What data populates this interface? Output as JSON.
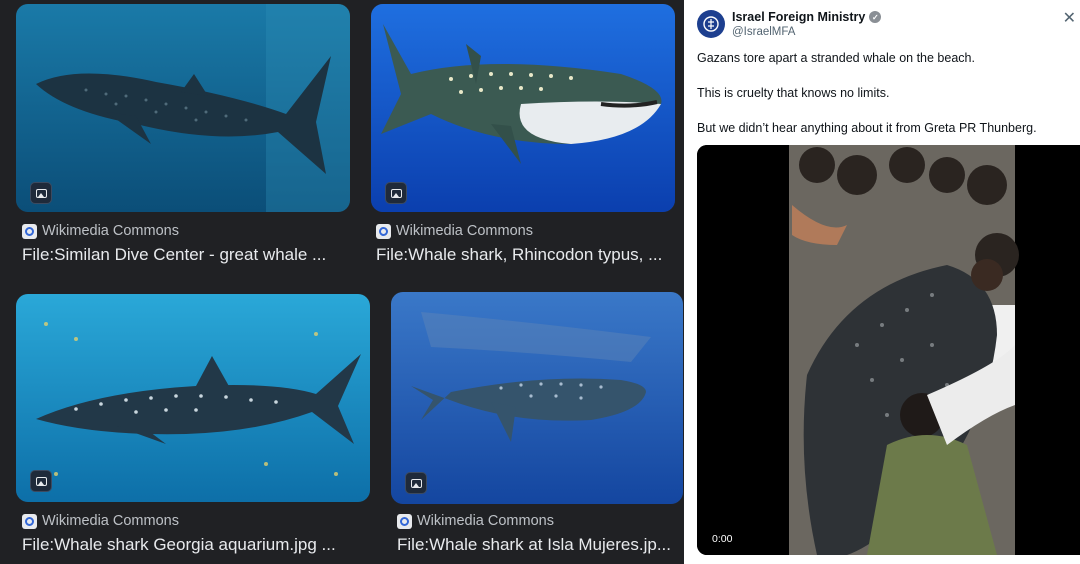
{
  "image_results": [
    {
      "source": "Wikimedia Commons",
      "title": "File:Similan Dive Center - great whale ..."
    },
    {
      "source": "Wikimedia Commons",
      "title": "File:Whale shark, Rhincodon typus, ..."
    },
    {
      "source": "Wikimedia Commons",
      "title": "File:Whale shark Georgia aquarium.jpg ..."
    },
    {
      "source": "Wikimedia Commons",
      "title": "File:Whale shark at Isla Mujeres.jp..."
    }
  ],
  "tweet": {
    "display_name": "Israel Foreign Ministry",
    "handle": "@IsraelMFA",
    "lines": [
      "Gazans tore apart a stranded whale on the beach.",
      "This is cruelty that knows no limits.",
      "But we didn’t hear anything about it from Greta PR Thunberg."
    ],
    "video_time": "0:00"
  },
  "icons": {
    "image_badge": "image-icon",
    "favicon": "wikimedia-icon",
    "verified": "verified-badge-icon",
    "close": "close-icon"
  }
}
